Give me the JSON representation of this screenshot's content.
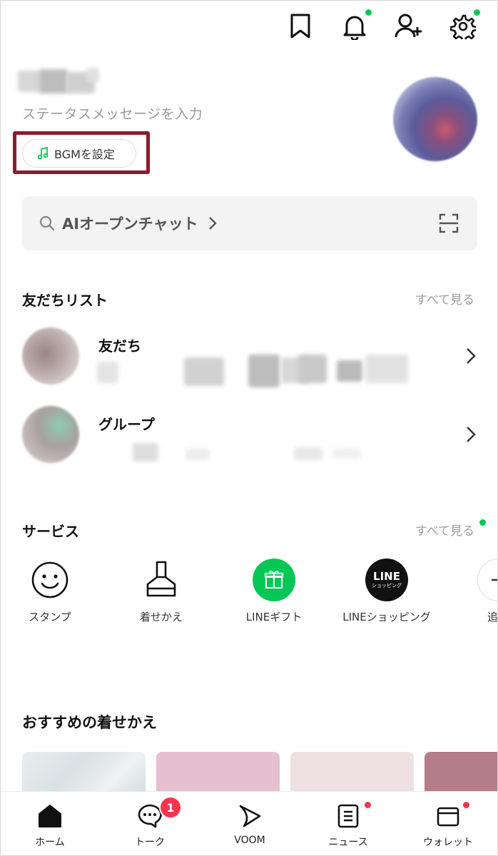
{
  "header": {
    "icons": [
      "bookmark-icon",
      "bell-icon",
      "add-friend-icon",
      "gear-icon"
    ],
    "accent_color": "#06c755"
  },
  "profile": {
    "status_placeholder": "ステータスメッセージを入力",
    "bgm_label": "BGMを設定"
  },
  "search": {
    "label": "AIオープンチャット"
  },
  "friends_section": {
    "title": "友だちリスト",
    "see_all": "すべて見る",
    "rows": [
      {
        "name": "友だち"
      },
      {
        "name": "グループ"
      }
    ]
  },
  "services_section": {
    "title": "サービス",
    "see_all": "すべて見る",
    "items": [
      {
        "label": "スタンプ",
        "icon": "smiley-icon"
      },
      {
        "label": "着せかえ",
        "icon": "brush-icon"
      },
      {
        "label": "LINEギフト",
        "icon": "gift-icon"
      },
      {
        "label": "LINEショッピング",
        "icon": "line-shopping-icon",
        "logo_text": "LINE",
        "logo_subtext": "ショッピング"
      },
      {
        "label": "追",
        "icon": "add-icon"
      }
    ]
  },
  "themes_section": {
    "title": "おすすめの着せかえ"
  },
  "tabbar": {
    "tabs": [
      {
        "label": "ホーム",
        "icon": "home-icon"
      },
      {
        "label": "トーク",
        "icon": "chat-icon",
        "badge": "1"
      },
      {
        "label": "VOOM",
        "icon": "voom-icon"
      },
      {
        "label": "ニュース",
        "icon": "news-icon"
      },
      {
        "label": "ウォレット",
        "icon": "wallet-icon"
      }
    ],
    "badge_color": "#ff334b"
  }
}
